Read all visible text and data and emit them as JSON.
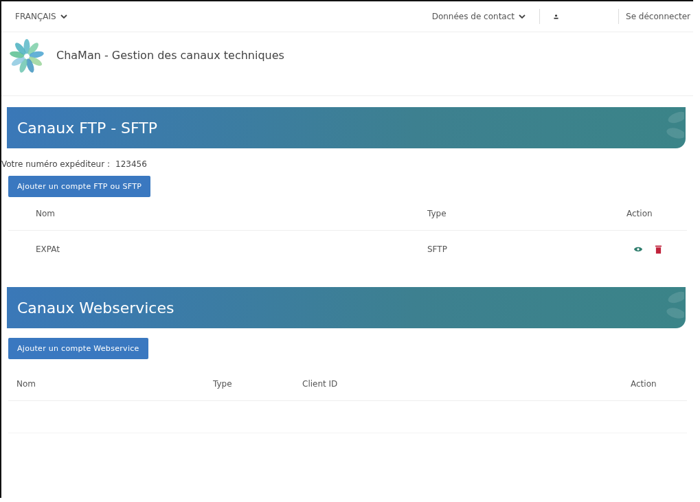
{
  "top_bar": {
    "language": "FRANÇAIS",
    "contact": "Données de contact",
    "logout": "Se déconnecter"
  },
  "header": {
    "title": "ChaMan - Gestion des canaux techniques"
  },
  "sections": [
    {
      "kind": "ftp",
      "title": "Canaux FTP - SFTP",
      "sender_label": "Votre numéro expéditeur :",
      "sender_number": "123456",
      "button": "Ajouter un compte FTP ou SFTP",
      "columns": [
        "Nom",
        "Type",
        "Action"
      ],
      "rows": [
        {
          "name": "EXPAt",
          "type": "SFTP"
        }
      ]
    },
    {
      "kind": "webservice",
      "title": "Canaux Webservices",
      "button": "Ajouter un compte Webservice",
      "columns": [
        "Nom",
        "Type",
        "Client ID",
        "Action"
      ]
    }
  ]
}
